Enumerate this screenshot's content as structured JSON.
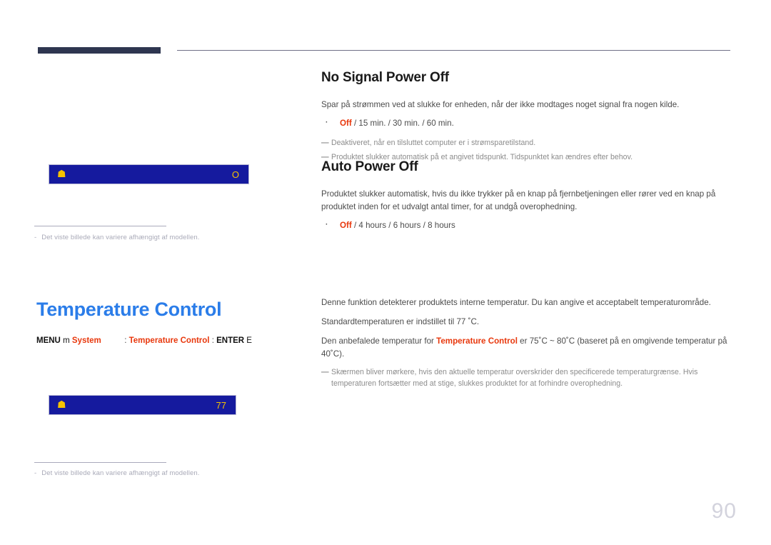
{
  "header": {
    "bar_color": "#2e3650",
    "rule_color": "#6f6f86"
  },
  "colors": {
    "accent_red": "#e8380d",
    "accent_blue": "#2b7de9",
    "osd_background": "#151a9e",
    "osd_text": "#f5c200",
    "page_number": "#d3d3dd"
  },
  "left": {
    "osd_box_1": {
      "icon": "osd-menu-icon",
      "icon_glyph": "☗",
      "value": "O"
    },
    "osd_box_2": {
      "icon": "osd-temperature-icon",
      "icon_glyph": "☗",
      "value": "77"
    },
    "footnote_1": {
      "dash": "-",
      "text": "Det viste billede kan variere afhængigt af modellen."
    },
    "footnote_2": {
      "dash": "-",
      "text": "Det viste billede kan variere afhængigt af modellen."
    },
    "temperature_heading": "Temperature Control",
    "menu_path": {
      "menu_label": "MENU",
      "menu_glyph": "m",
      "system_label": "System",
      "separator_1": ":",
      "target_label": "Temperature Control",
      "separator_2": ":",
      "enter_label": "ENTER",
      "enter_glyph": "E"
    }
  },
  "right": {
    "no_signal_power_off": {
      "title": "No Signal Power Off",
      "description": "Spar på strømmen ved at slukke for enheden, når der ikke modtages noget signal fra nogen kilde.",
      "bullet_dot": "·",
      "options_first": "Off",
      "options_rest": " / 15 min. / 30 min. / 60 min.",
      "notes": [
        "Deaktiveret, når en tilsluttet computer er i strømsparetilstand.",
        "Produktet slukker automatisk på et angivet tidspunkt. Tidspunktet kan ændres efter behov."
      ],
      "note_dash": "—"
    },
    "auto_power_off": {
      "title": "Auto Power Off",
      "description": "Produktet slukker automatisk, hvis du ikke trykker på en knap på fjernbetjeningen eller rører ved en knap på produktet inden for et udvalgt antal timer, for at undgå overophedning.",
      "bullet_dot": "·",
      "options_first": "Off",
      "options_rest": " / 4 hours / 6 hours / 8 hours"
    },
    "temperature_control": {
      "paragraph_1": "Denne funktion detekterer produktets interne temperatur. Du kan angive et acceptabelt temperaturområde.",
      "paragraph_2": "Standardtemperaturen er indstillet til 77 ˚C.",
      "paragraph_3_before": "Den anbefalede temperatur for ",
      "paragraph_3_highlight": "Temperature Control",
      "paragraph_3_after": " er 75˚C ~ 80˚C (baseret på en omgivende temperatur på 40˚C).",
      "note_dash": "—",
      "note": "Skærmen bliver mørkere, hvis den aktuelle temperatur overskrider den specificerede temperaturgrænse. Hvis temperaturen fortsætter med at stige, slukkes produktet for at forhindre overophedning."
    }
  },
  "page_number": "90"
}
